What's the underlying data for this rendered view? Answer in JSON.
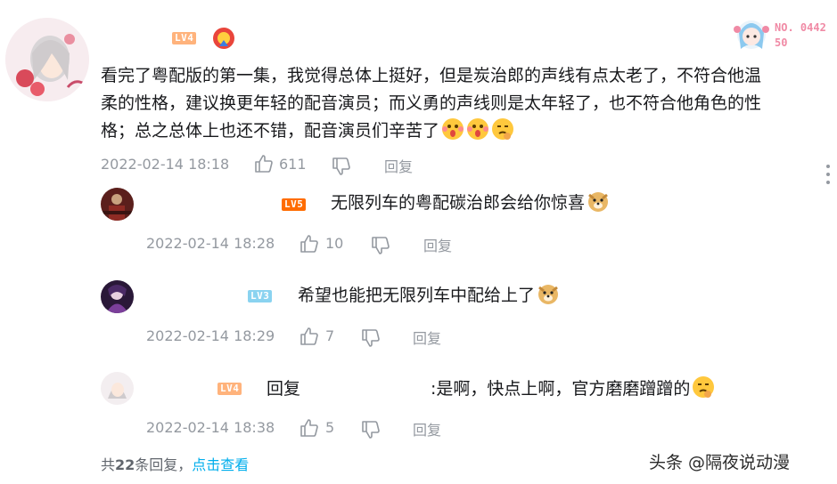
{
  "main_comment": {
    "level": "LV4",
    "text_lines": [
      "看完了粤配版的第一集，我觉得总体上挺好，但是炭治郎的声线有点太老了，不符合他温",
      "柔的性格，建议换更年轻的配音演员；而义勇的声线则是太年轻了，也不符合他角色的性",
      "格；总之总体上也还不错，配音演员们辛苦了"
    ],
    "timestamp": "2022-02-14 18:18",
    "likes": "611",
    "reply_label": "回复",
    "fan_badge_number": "NO. 044250"
  },
  "replies": [
    {
      "level": "LV5",
      "text": "无限列车的粤配碳治郎会给你惊喜",
      "timestamp": "2022-02-14 18:28",
      "likes": "10",
      "reply_label": "回复"
    },
    {
      "level": "LV3",
      "text": "希望也能把无限列车中配给上了",
      "timestamp": "2022-02-14 18:29",
      "likes": "7",
      "reply_label": "回复"
    },
    {
      "level": "LV4",
      "reply_prefix": "回复",
      "text": ":是啊，快点上啊，官方磨磨蹭蹭的",
      "timestamp": "2022-02-14 18:38",
      "likes": "5",
      "reply_label": "回复"
    }
  ],
  "footer": {
    "total_prefix": "共",
    "total_count": "22",
    "total_suffix": "条回复，",
    "view_link": "点击查看"
  },
  "watermark": "头条 @隔夜说动漫",
  "colors": {
    "lv3": "#8ad3f0",
    "lv4": "#ffb37c",
    "lv5": "#ff6c00",
    "link": "#00aeec",
    "meta": "#9499a0"
  },
  "icons": {
    "like": "thumbs-up-icon",
    "dislike": "thumbs-down-icon",
    "more": "more-vertical-icon"
  }
}
